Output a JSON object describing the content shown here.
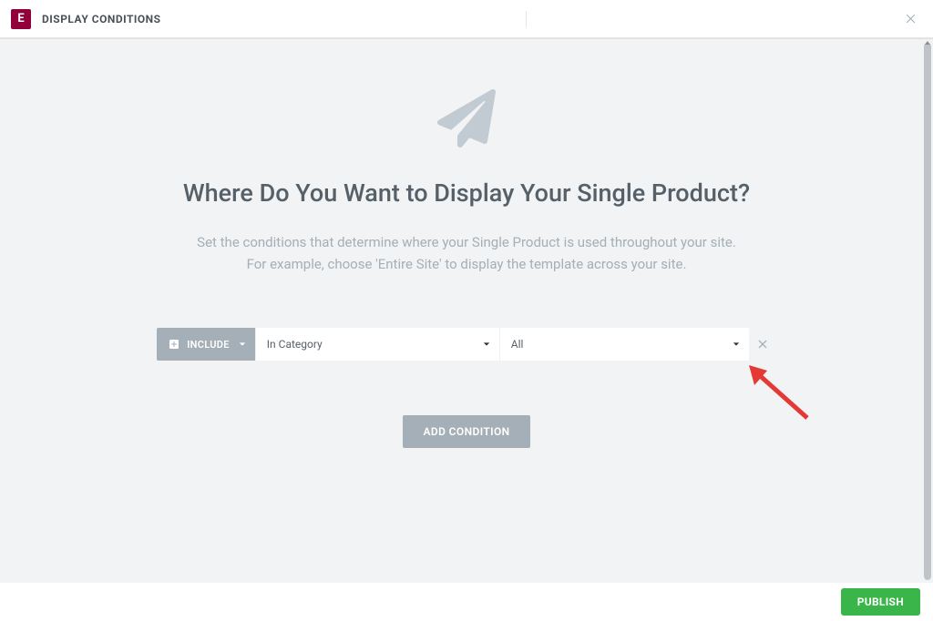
{
  "header": {
    "logo_letter": "E",
    "title": "DISPLAY CONDITIONS"
  },
  "main": {
    "heading": "Where Do You Want to Display Your Single Product?",
    "description_line1": "Set the conditions that determine where your Single Product is used throughout your site.",
    "description_line2": "For example, choose 'Entire Site' to display the template across your site."
  },
  "condition_row": {
    "include_label": "INCLUDE",
    "type_value": "In Category",
    "filter_value": "All"
  },
  "buttons": {
    "add_condition": "ADD CONDITION",
    "publish": "PUBLISH"
  }
}
